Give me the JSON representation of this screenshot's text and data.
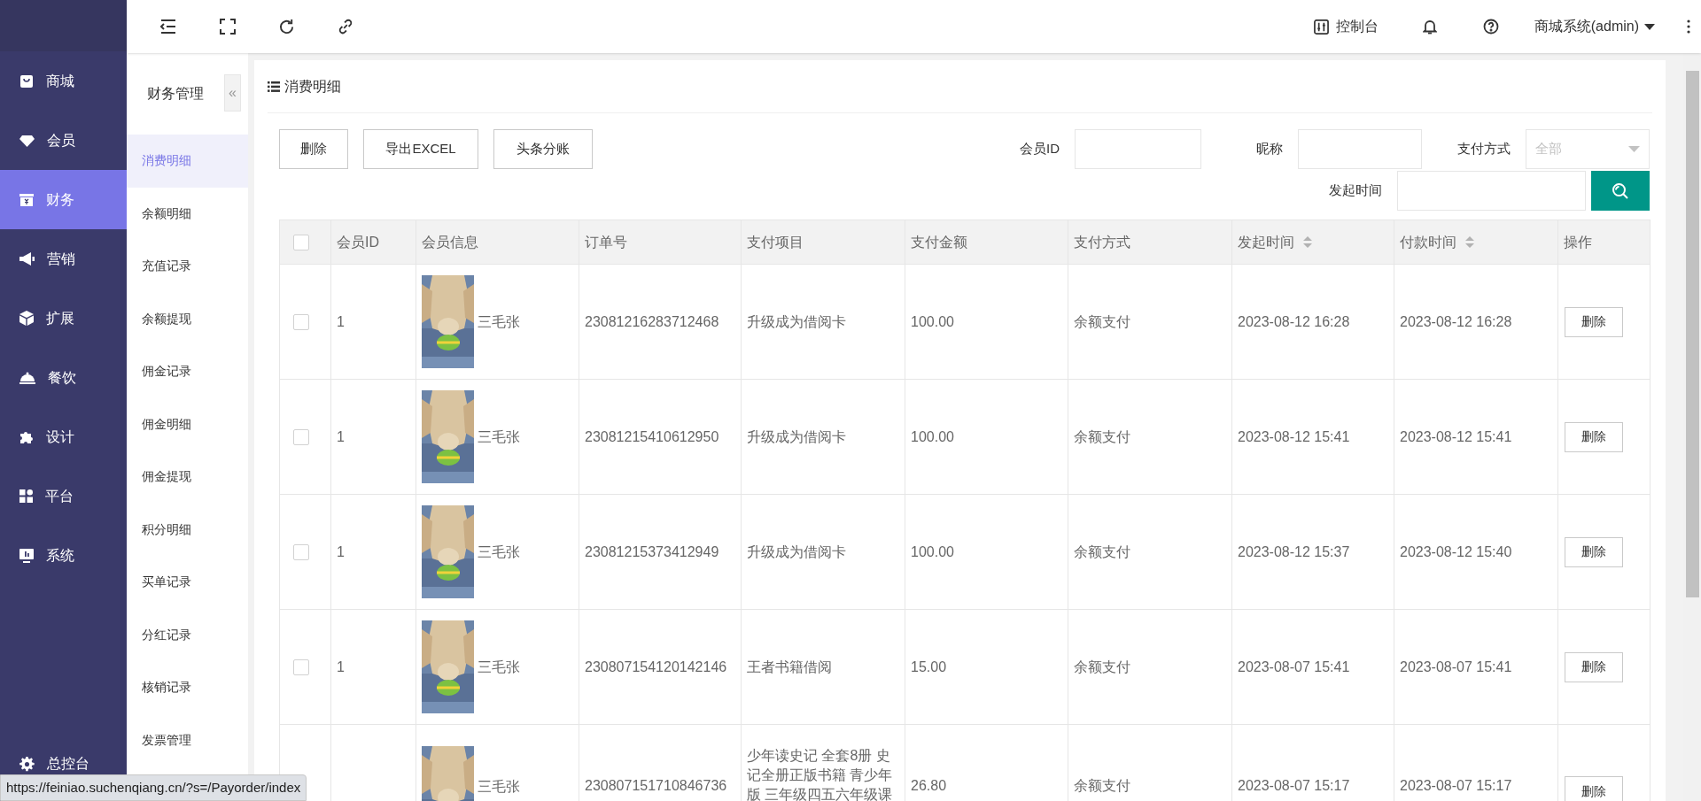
{
  "sidebar": {
    "items": [
      {
        "label": "商城",
        "selected": false
      },
      {
        "label": "会员",
        "selected": false
      },
      {
        "label": "财务",
        "selected": true
      },
      {
        "label": "营销",
        "selected": false
      },
      {
        "label": "扩展",
        "selected": false
      },
      {
        "label": "餐饮",
        "selected": false
      },
      {
        "label": "设计",
        "selected": false
      },
      {
        "label": "平台",
        "selected": false
      },
      {
        "label": "系统",
        "selected": false
      }
    ],
    "footer": "总控台"
  },
  "topbar": {
    "console": "控制台",
    "user": "商城系统(admin)"
  },
  "submenu": {
    "title": "财务管理",
    "collapse": "«",
    "items": [
      {
        "label": "消费明细",
        "selected": true
      },
      {
        "label": "余额明细",
        "selected": false
      },
      {
        "label": "充值记录",
        "selected": false
      },
      {
        "label": "余额提现",
        "selected": false
      },
      {
        "label": "佣金记录",
        "selected": false
      },
      {
        "label": "佣金明细",
        "selected": false
      },
      {
        "label": "佣金提现",
        "selected": false
      },
      {
        "label": "积分明细",
        "selected": false
      },
      {
        "label": "买单记录",
        "selected": false
      },
      {
        "label": "分红记录",
        "selected": false
      },
      {
        "label": "核销记录",
        "selected": false
      },
      {
        "label": "发票管理",
        "selected": false
      }
    ]
  },
  "panel": {
    "title": "消费明细",
    "buttons": [
      "删除",
      "导出EXCEL",
      "头条分账"
    ],
    "filters": [
      {
        "kind": "input",
        "label": "会员ID"
      },
      {
        "kind": "input",
        "label": "昵称"
      },
      {
        "kind": "select",
        "label": "支付方式",
        "placeholder": "全部"
      },
      {
        "kind": "input",
        "label": "发起时间"
      }
    ]
  },
  "table": {
    "header_checked": false,
    "columns": [
      {
        "label": "会员ID",
        "sortable": false
      },
      {
        "label": "会员信息",
        "sortable": false
      },
      {
        "label": "订单号",
        "sortable": false
      },
      {
        "label": "支付项目",
        "sortable": false
      },
      {
        "label": "支付金额",
        "sortable": false
      },
      {
        "label": "支付方式",
        "sortable": false
      },
      {
        "label": "发起时间",
        "sortable": true
      },
      {
        "label": "付款时间",
        "sortable": true
      },
      {
        "label": "操作",
        "sortable": false
      }
    ],
    "rows": [
      {
        "checked": false,
        "member_id": "1",
        "nickname": "三毛张",
        "order_no": "23081216283712468",
        "item": "升级成为借阅卡",
        "amount": "100.00",
        "method": "余额支付",
        "created": "2023-08-12 16:28",
        "paid": "2023-08-12 16:28",
        "action": "删除"
      },
      {
        "checked": false,
        "member_id": "1",
        "nickname": "三毛张",
        "order_no": "23081215410612950",
        "item": "升级成为借阅卡",
        "amount": "100.00",
        "method": "余额支付",
        "created": "2023-08-12 15:41",
        "paid": "2023-08-12 15:41",
        "action": "删除"
      },
      {
        "checked": false,
        "member_id": "1",
        "nickname": "三毛张",
        "order_no": "23081215373412949",
        "item": "升级成为借阅卡",
        "amount": "100.00",
        "method": "余额支付",
        "created": "2023-08-12 15:37",
        "paid": "2023-08-12 15:40",
        "action": "删除"
      },
      {
        "checked": false,
        "member_id": "1",
        "nickname": "三毛张",
        "order_no": "230807154120142146",
        "item": "王者书籍借阅",
        "amount": "15.00",
        "method": "余额支付",
        "created": "2023-08-07 15:41",
        "paid": "2023-08-07 15:41",
        "action": "删除"
      },
      {
        "nickname": "三毛张",
        "order_no": "230807151710846736",
        "item": "少年读史记 全套8册 史记全册正版书籍 青少年版 三年级四五六年级课",
        "amount": "26.80",
        "method": "余额支付",
        "created": "2023-08-07 15:17",
        "paid": "2023-08-07 15:17",
        "action": "删除"
      }
    ]
  },
  "status_url": "https://feiniao.suchenqiang.cn/?s=/Payorder/index"
}
